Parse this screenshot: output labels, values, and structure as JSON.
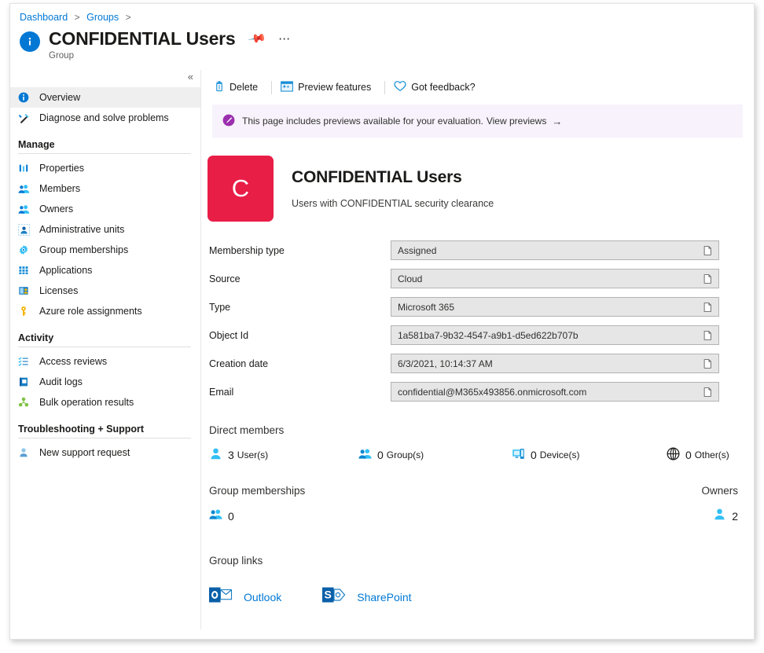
{
  "breadcrumb": {
    "items": [
      {
        "label": "Dashboard"
      },
      {
        "label": "Groups"
      }
    ],
    "separator": ">"
  },
  "header": {
    "title": "CONFIDENTIAL Users",
    "subtitle": "Group",
    "info_icon": "i",
    "pin_icon": "pin-icon",
    "more_icon": "ellipsis-icon"
  },
  "sidebar": {
    "collapse_label": "«",
    "items": [
      {
        "label": "Overview",
        "icon": "info-icon",
        "active": true
      },
      {
        "label": "Diagnose and solve problems",
        "icon": "wrench-icon",
        "active": false
      }
    ],
    "sections": [
      {
        "title": "Manage",
        "items": [
          {
            "label": "Properties",
            "icon": "properties-icon"
          },
          {
            "label": "Members",
            "icon": "members-icon"
          },
          {
            "label": "Owners",
            "icon": "owners-icon"
          },
          {
            "label": "Administrative units",
            "icon": "administrative-units-icon"
          },
          {
            "label": "Group memberships",
            "icon": "group-memberships-icon"
          },
          {
            "label": "Applications",
            "icon": "applications-icon"
          },
          {
            "label": "Licenses",
            "icon": "licenses-icon"
          },
          {
            "label": "Azure role assignments",
            "icon": "key-icon"
          }
        ]
      },
      {
        "title": "Activity",
        "items": [
          {
            "label": "Access reviews",
            "icon": "access-reviews-icon"
          },
          {
            "label": "Audit logs",
            "icon": "audit-logs-icon"
          },
          {
            "label": "Bulk operation results",
            "icon": "bulk-operation-icon"
          }
        ]
      },
      {
        "title": "Troubleshooting + Support",
        "items": [
          {
            "label": "New support request",
            "icon": "support-person-icon"
          }
        ]
      }
    ]
  },
  "toolbar": {
    "delete_label": "Delete",
    "preview_features_label": "Preview features",
    "feedback_label": "Got feedback?",
    "delete_icon": "trash-icon",
    "preview_icon": "preview-features-icon",
    "feedback_icon": "heart-icon"
  },
  "banner": {
    "icon": "megaphone-icon",
    "text": "This page includes previews available for your evaluation.",
    "link": "View previews",
    "arrow": "→",
    "background": "#f7f2fb",
    "icon_color": "#8a2be2"
  },
  "group": {
    "avatar_letter": "C",
    "avatar_color": "#e81e47",
    "name": "CONFIDENTIAL Users",
    "description": "Users with CONFIDENTIAL security clearance"
  },
  "properties": [
    {
      "label": "Membership type",
      "value": "Assigned",
      "copy_icon": "copy-icon"
    },
    {
      "label": "Source",
      "value": "Cloud",
      "copy_icon": "copy-icon"
    },
    {
      "label": "Type",
      "value": "Microsoft 365",
      "copy_icon": "copy-icon"
    },
    {
      "label": "Object Id",
      "value": "1a581ba7-9b32-4547-a9b1-d5ed622b707b",
      "copy_icon": "copy-icon"
    },
    {
      "label": "Creation date",
      "value": "6/3/2021, 10:14:37 AM",
      "copy_icon": "copy-icon"
    },
    {
      "label": "Email",
      "value": "confidential@M365x493856.onmicrosoft.com",
      "copy_icon": "copy-icon"
    }
  ],
  "direct_members": {
    "title": "Direct members",
    "stats": [
      {
        "count": "3",
        "unit": "User(s)",
        "icon": "user-icon"
      },
      {
        "count": "0",
        "unit": "Group(s)",
        "icon": "group-icon"
      },
      {
        "count": "0",
        "unit": "Device(s)",
        "icon": "device-icon"
      },
      {
        "count": "0",
        "unit": "Other(s)",
        "icon": "globe-icon"
      }
    ]
  },
  "group_memberships": {
    "title": "Group memberships",
    "count": "0",
    "icon": "group-icon"
  },
  "owners": {
    "title": "Owners",
    "count": "2",
    "icon": "user-icon"
  },
  "group_links": {
    "title": "Group links",
    "links": [
      {
        "label": "Outlook",
        "icon": "outlook-icon"
      },
      {
        "label": "SharePoint",
        "icon": "sharepoint-icon"
      }
    ]
  }
}
